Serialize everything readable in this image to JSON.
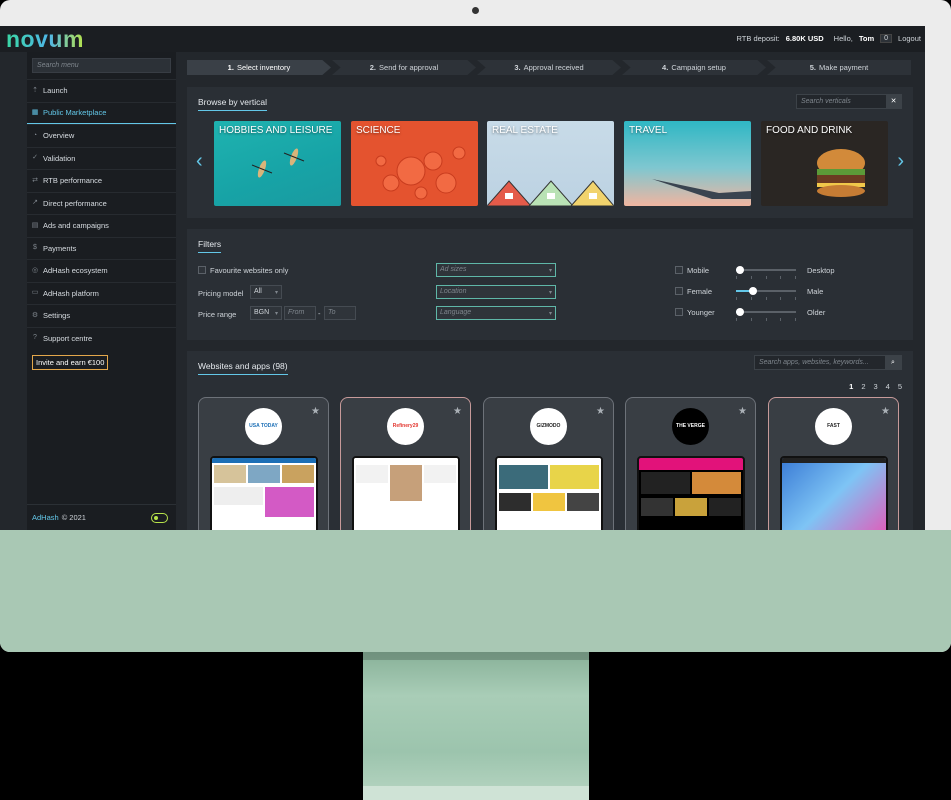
{
  "topbar": {
    "logo": "novum",
    "deposit_label": "RTB deposit:",
    "deposit_value": "6.80K USD",
    "greeting": "Hello,",
    "user": "Tom",
    "notifications": "0",
    "logout": "Logout"
  },
  "sidebar": {
    "search_placeholder": "Search menu",
    "items": [
      {
        "label": "Launch",
        "icon": "launch-icon"
      },
      {
        "label": "Public Marketplace",
        "icon": "marketplace-icon",
        "active": true
      },
      {
        "label": "Overview",
        "icon": "overview-icon"
      },
      {
        "label": "Validation",
        "icon": "validation-icon"
      },
      {
        "label": "RTB performance",
        "icon": "rtb-icon"
      },
      {
        "label": "Direct performance",
        "icon": "direct-icon"
      },
      {
        "label": "Ads and campaigns",
        "icon": "ads-icon"
      },
      {
        "label": "Payments",
        "icon": "payments-icon"
      },
      {
        "label": "AdHash ecosystem",
        "icon": "ecosystem-icon"
      },
      {
        "label": "AdHash platform",
        "icon": "platform-icon"
      },
      {
        "label": "Settings",
        "icon": "gear-icon"
      },
      {
        "label": "Support centre",
        "icon": "support-icon"
      }
    ],
    "invite": "Invite and earn €100",
    "footer_brand": "AdHash",
    "footer_copy": "© 2021"
  },
  "steps": [
    {
      "num": "1.",
      "label": "Select inventory"
    },
    {
      "num": "2.",
      "label": "Send for approval"
    },
    {
      "num": "3.",
      "label": "Approval received"
    },
    {
      "num": "4.",
      "label": "Campaign setup"
    },
    {
      "num": "5.",
      "label": "Make payment"
    }
  ],
  "verticals": {
    "title": "Browse by vertical",
    "search_placeholder": "Search verticals",
    "tiles": [
      {
        "label": "HOBBIES AND LEISURE"
      },
      {
        "label": "SCIENCE"
      },
      {
        "label": "REAL ESTATE"
      },
      {
        "label": "TRAVEL"
      },
      {
        "label": "FOOD AND DRINK"
      }
    ]
  },
  "filters": {
    "title": "Filters",
    "favourite": "Favourite websites only",
    "pricing_model_label": "Pricing model",
    "pricing_model_value": "All",
    "price_range_label": "Price range",
    "currency": "BGN",
    "from_placeholder": "From",
    "dash": "-",
    "to_placeholder": "To",
    "ad_sizes": "Ad sizes",
    "location": "Location",
    "language": "Language",
    "device": {
      "left": "Mobile",
      "right": "Desktop",
      "level": 0.0
    },
    "gender": {
      "left": "Female",
      "right": "Male",
      "level": 0.25
    },
    "age": {
      "left": "Younger",
      "right": "Older",
      "level": 0.0
    }
  },
  "websites": {
    "title": "Websites and apps (98)",
    "search_placeholder": "Search apps, websites, keywords...",
    "pages": [
      "1",
      "2",
      "3",
      "4",
      "5"
    ],
    "current_page": "1",
    "cards": [
      {
        "name": "USA TODAY"
      },
      {
        "name": "Refinery29"
      },
      {
        "name": "GIZMODO"
      },
      {
        "name": "THE VERGE"
      },
      {
        "name": "FAST COMPANY"
      }
    ]
  }
}
